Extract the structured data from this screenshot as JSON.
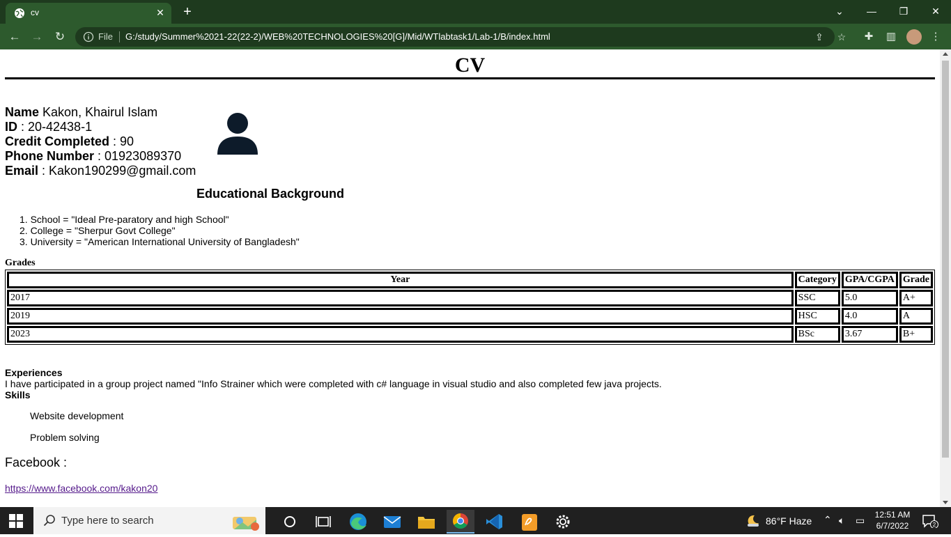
{
  "browser": {
    "tab_title": "cv",
    "file_label": "File",
    "url": "G:/study/Summer%2021-22(22-2)/WEB%20TECHNOLOGIES%20[G]/Mid/WTlabtask1/Lab-1/B/index.html"
  },
  "cv": {
    "title": "CV",
    "name_label": "Name",
    "name_value": " Kakon, Khairul Islam",
    "id_label": "ID",
    "id_value": " : 20-42438-1",
    "credit_label": "Credit Completed",
    "credit_value": " : 90",
    "phone_label": "Phone Number",
    "phone_value": " : 01923089370",
    "email_label": "Email",
    "email_value": " : Kakon190299@gmail.com",
    "education_heading": "Educational Background",
    "education": [
      "1. School = \"Ideal Pre-paratory and high School\"",
      "2. College = \"Sherpur Govt College\"",
      "3. University = \"American International University of Bangladesh\""
    ],
    "grades_label": "Grades",
    "grades_headers": [
      "Year",
      "Category",
      "GPA/CGPA",
      "Grade"
    ],
    "grades_rows": [
      [
        "2017",
        "SSC",
        "5.0",
        "A+"
      ],
      [
        "2019",
        "HSC",
        "4.0",
        "A"
      ],
      [
        "2023",
        "BSc",
        "3.67",
        "B+"
      ]
    ],
    "experiences_label": "Experiences",
    "experiences_text": "I have participated in a group project named \"Info Strainer which were completed with c# language in visual studio and also completed few java projects.",
    "skills_label": "Skills",
    "skills": [
      "Website development",
      "Problem solving"
    ],
    "facebook_label": "Facebook :",
    "facebook_link": "https://www.facebook.com/kakon20"
  },
  "taskbar": {
    "search_placeholder": "Type here to search",
    "weather": "86°F  Haze",
    "time": "12:51 AM",
    "date": "6/7/2022",
    "notification_count": "2"
  }
}
